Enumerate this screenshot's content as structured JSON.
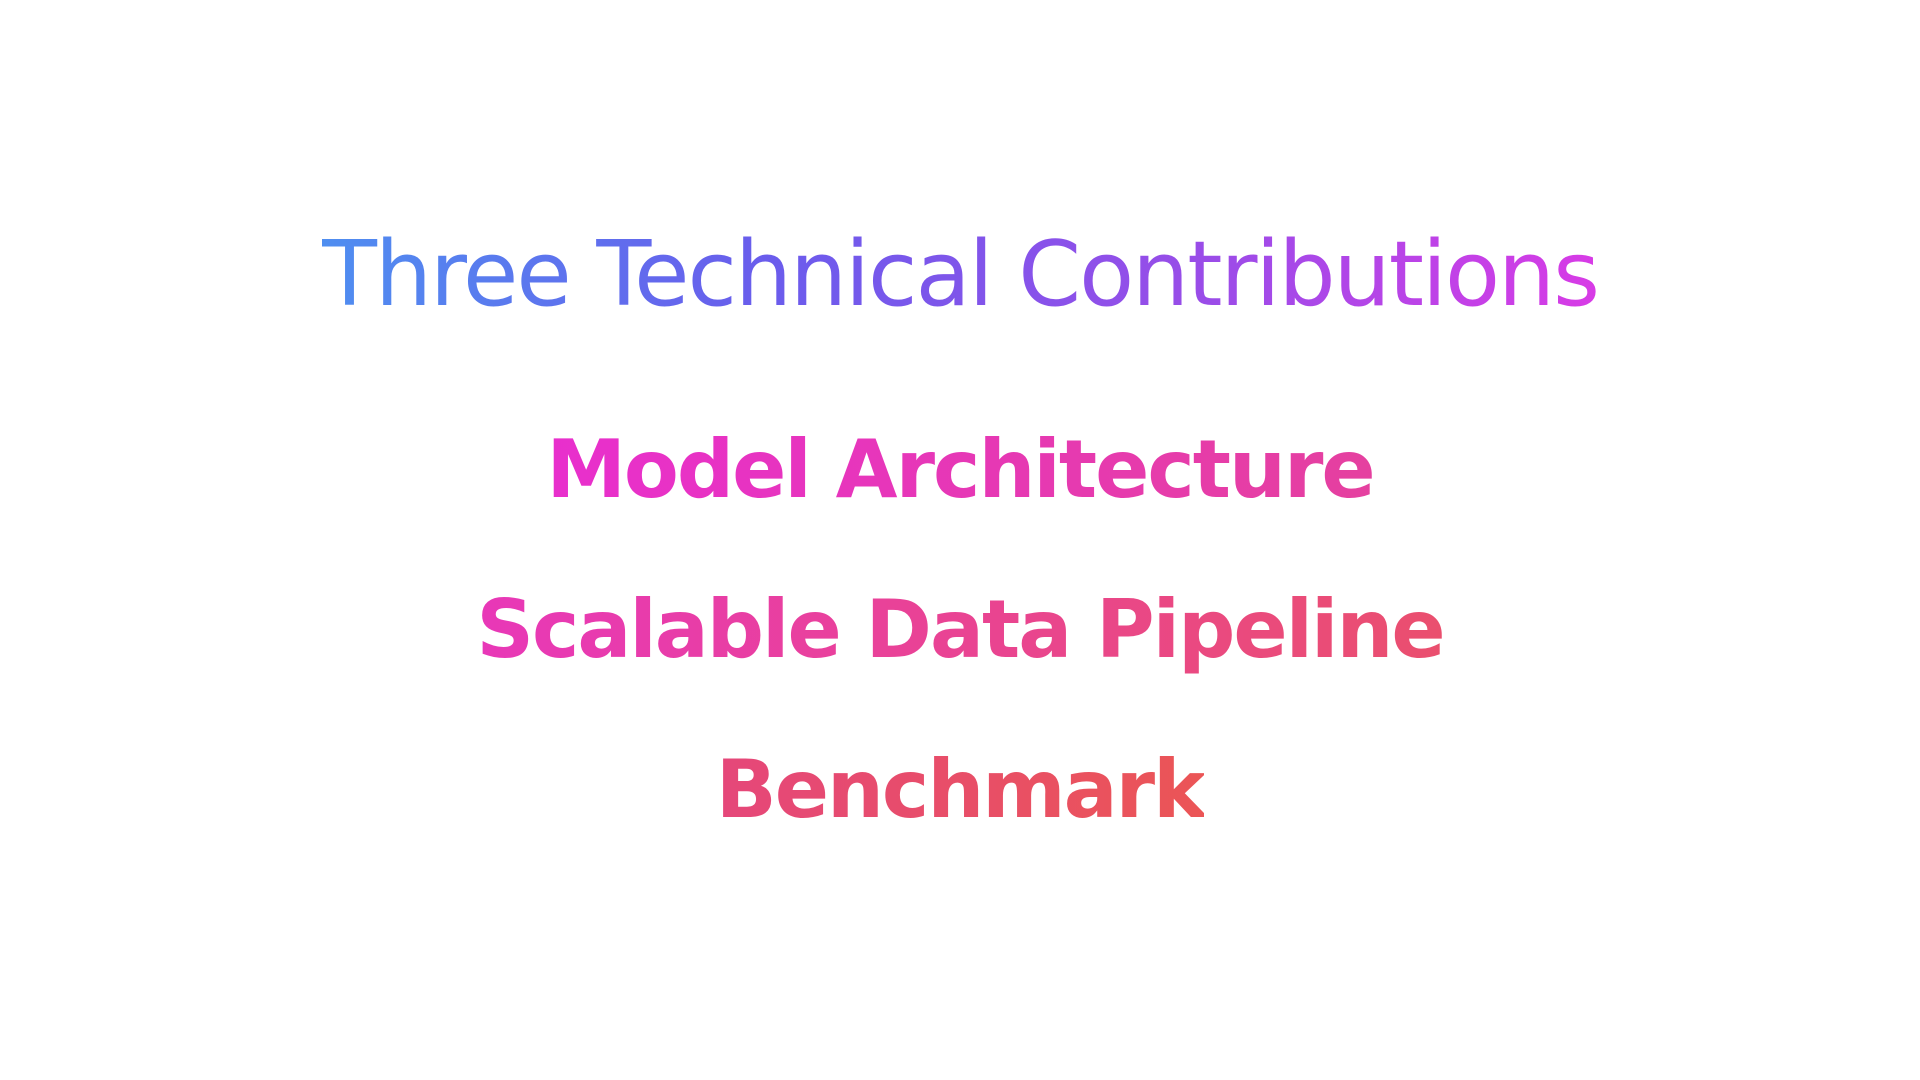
{
  "slide": {
    "title": "Three Technical Contributions",
    "contributions": [
      {
        "label": "Model Architecture"
      },
      {
        "label": "Scalable Data Pipeline"
      },
      {
        "label": "Benchmark"
      }
    ]
  },
  "colors": {
    "title_gradient": [
      "#4f8ef0",
      "#6a5cec",
      "#9b4ce8",
      "#d83be6"
    ],
    "item_gradient_start": "#e82fcd",
    "item_gradient_end": "#eb5556",
    "background": "#ffffff"
  }
}
